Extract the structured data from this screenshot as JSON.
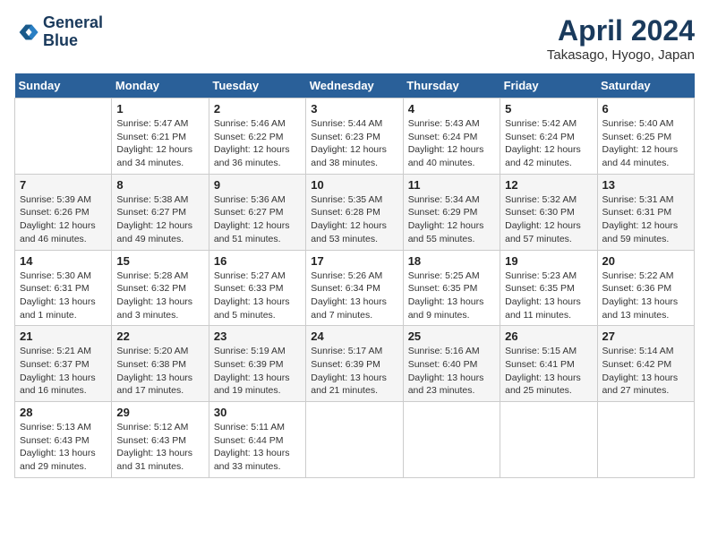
{
  "logo": {
    "line1": "General",
    "line2": "Blue"
  },
  "title": "April 2024",
  "subtitle": "Takasago, Hyogo, Japan",
  "days_of_week": [
    "Sunday",
    "Monday",
    "Tuesday",
    "Wednesday",
    "Thursday",
    "Friday",
    "Saturday"
  ],
  "weeks": [
    [
      {
        "day": "",
        "info": ""
      },
      {
        "day": "1",
        "info": "Sunrise: 5:47 AM\nSunset: 6:21 PM\nDaylight: 12 hours\nand 34 minutes."
      },
      {
        "day": "2",
        "info": "Sunrise: 5:46 AM\nSunset: 6:22 PM\nDaylight: 12 hours\nand 36 minutes."
      },
      {
        "day": "3",
        "info": "Sunrise: 5:44 AM\nSunset: 6:23 PM\nDaylight: 12 hours\nand 38 minutes."
      },
      {
        "day": "4",
        "info": "Sunrise: 5:43 AM\nSunset: 6:24 PM\nDaylight: 12 hours\nand 40 minutes."
      },
      {
        "day": "5",
        "info": "Sunrise: 5:42 AM\nSunset: 6:24 PM\nDaylight: 12 hours\nand 42 minutes."
      },
      {
        "day": "6",
        "info": "Sunrise: 5:40 AM\nSunset: 6:25 PM\nDaylight: 12 hours\nand 44 minutes."
      }
    ],
    [
      {
        "day": "7",
        "info": "Sunrise: 5:39 AM\nSunset: 6:26 PM\nDaylight: 12 hours\nand 46 minutes."
      },
      {
        "day": "8",
        "info": "Sunrise: 5:38 AM\nSunset: 6:27 PM\nDaylight: 12 hours\nand 49 minutes."
      },
      {
        "day": "9",
        "info": "Sunrise: 5:36 AM\nSunset: 6:27 PM\nDaylight: 12 hours\nand 51 minutes."
      },
      {
        "day": "10",
        "info": "Sunrise: 5:35 AM\nSunset: 6:28 PM\nDaylight: 12 hours\nand 53 minutes."
      },
      {
        "day": "11",
        "info": "Sunrise: 5:34 AM\nSunset: 6:29 PM\nDaylight: 12 hours\nand 55 minutes."
      },
      {
        "day": "12",
        "info": "Sunrise: 5:32 AM\nSunset: 6:30 PM\nDaylight: 12 hours\nand 57 minutes."
      },
      {
        "day": "13",
        "info": "Sunrise: 5:31 AM\nSunset: 6:31 PM\nDaylight: 12 hours\nand 59 minutes."
      }
    ],
    [
      {
        "day": "14",
        "info": "Sunrise: 5:30 AM\nSunset: 6:31 PM\nDaylight: 13 hours\nand 1 minute."
      },
      {
        "day": "15",
        "info": "Sunrise: 5:28 AM\nSunset: 6:32 PM\nDaylight: 13 hours\nand 3 minutes."
      },
      {
        "day": "16",
        "info": "Sunrise: 5:27 AM\nSunset: 6:33 PM\nDaylight: 13 hours\nand 5 minutes."
      },
      {
        "day": "17",
        "info": "Sunrise: 5:26 AM\nSunset: 6:34 PM\nDaylight: 13 hours\nand 7 minutes."
      },
      {
        "day": "18",
        "info": "Sunrise: 5:25 AM\nSunset: 6:35 PM\nDaylight: 13 hours\nand 9 minutes."
      },
      {
        "day": "19",
        "info": "Sunrise: 5:23 AM\nSunset: 6:35 PM\nDaylight: 13 hours\nand 11 minutes."
      },
      {
        "day": "20",
        "info": "Sunrise: 5:22 AM\nSunset: 6:36 PM\nDaylight: 13 hours\nand 13 minutes."
      }
    ],
    [
      {
        "day": "21",
        "info": "Sunrise: 5:21 AM\nSunset: 6:37 PM\nDaylight: 13 hours\nand 16 minutes."
      },
      {
        "day": "22",
        "info": "Sunrise: 5:20 AM\nSunset: 6:38 PM\nDaylight: 13 hours\nand 17 minutes."
      },
      {
        "day": "23",
        "info": "Sunrise: 5:19 AM\nSunset: 6:39 PM\nDaylight: 13 hours\nand 19 minutes."
      },
      {
        "day": "24",
        "info": "Sunrise: 5:17 AM\nSunset: 6:39 PM\nDaylight: 13 hours\nand 21 minutes."
      },
      {
        "day": "25",
        "info": "Sunrise: 5:16 AM\nSunset: 6:40 PM\nDaylight: 13 hours\nand 23 minutes."
      },
      {
        "day": "26",
        "info": "Sunrise: 5:15 AM\nSunset: 6:41 PM\nDaylight: 13 hours\nand 25 minutes."
      },
      {
        "day": "27",
        "info": "Sunrise: 5:14 AM\nSunset: 6:42 PM\nDaylight: 13 hours\nand 27 minutes."
      }
    ],
    [
      {
        "day": "28",
        "info": "Sunrise: 5:13 AM\nSunset: 6:43 PM\nDaylight: 13 hours\nand 29 minutes."
      },
      {
        "day": "29",
        "info": "Sunrise: 5:12 AM\nSunset: 6:43 PM\nDaylight: 13 hours\nand 31 minutes."
      },
      {
        "day": "30",
        "info": "Sunrise: 5:11 AM\nSunset: 6:44 PM\nDaylight: 13 hours\nand 33 minutes."
      },
      {
        "day": "",
        "info": ""
      },
      {
        "day": "",
        "info": ""
      },
      {
        "day": "",
        "info": ""
      },
      {
        "day": "",
        "info": ""
      }
    ]
  ]
}
